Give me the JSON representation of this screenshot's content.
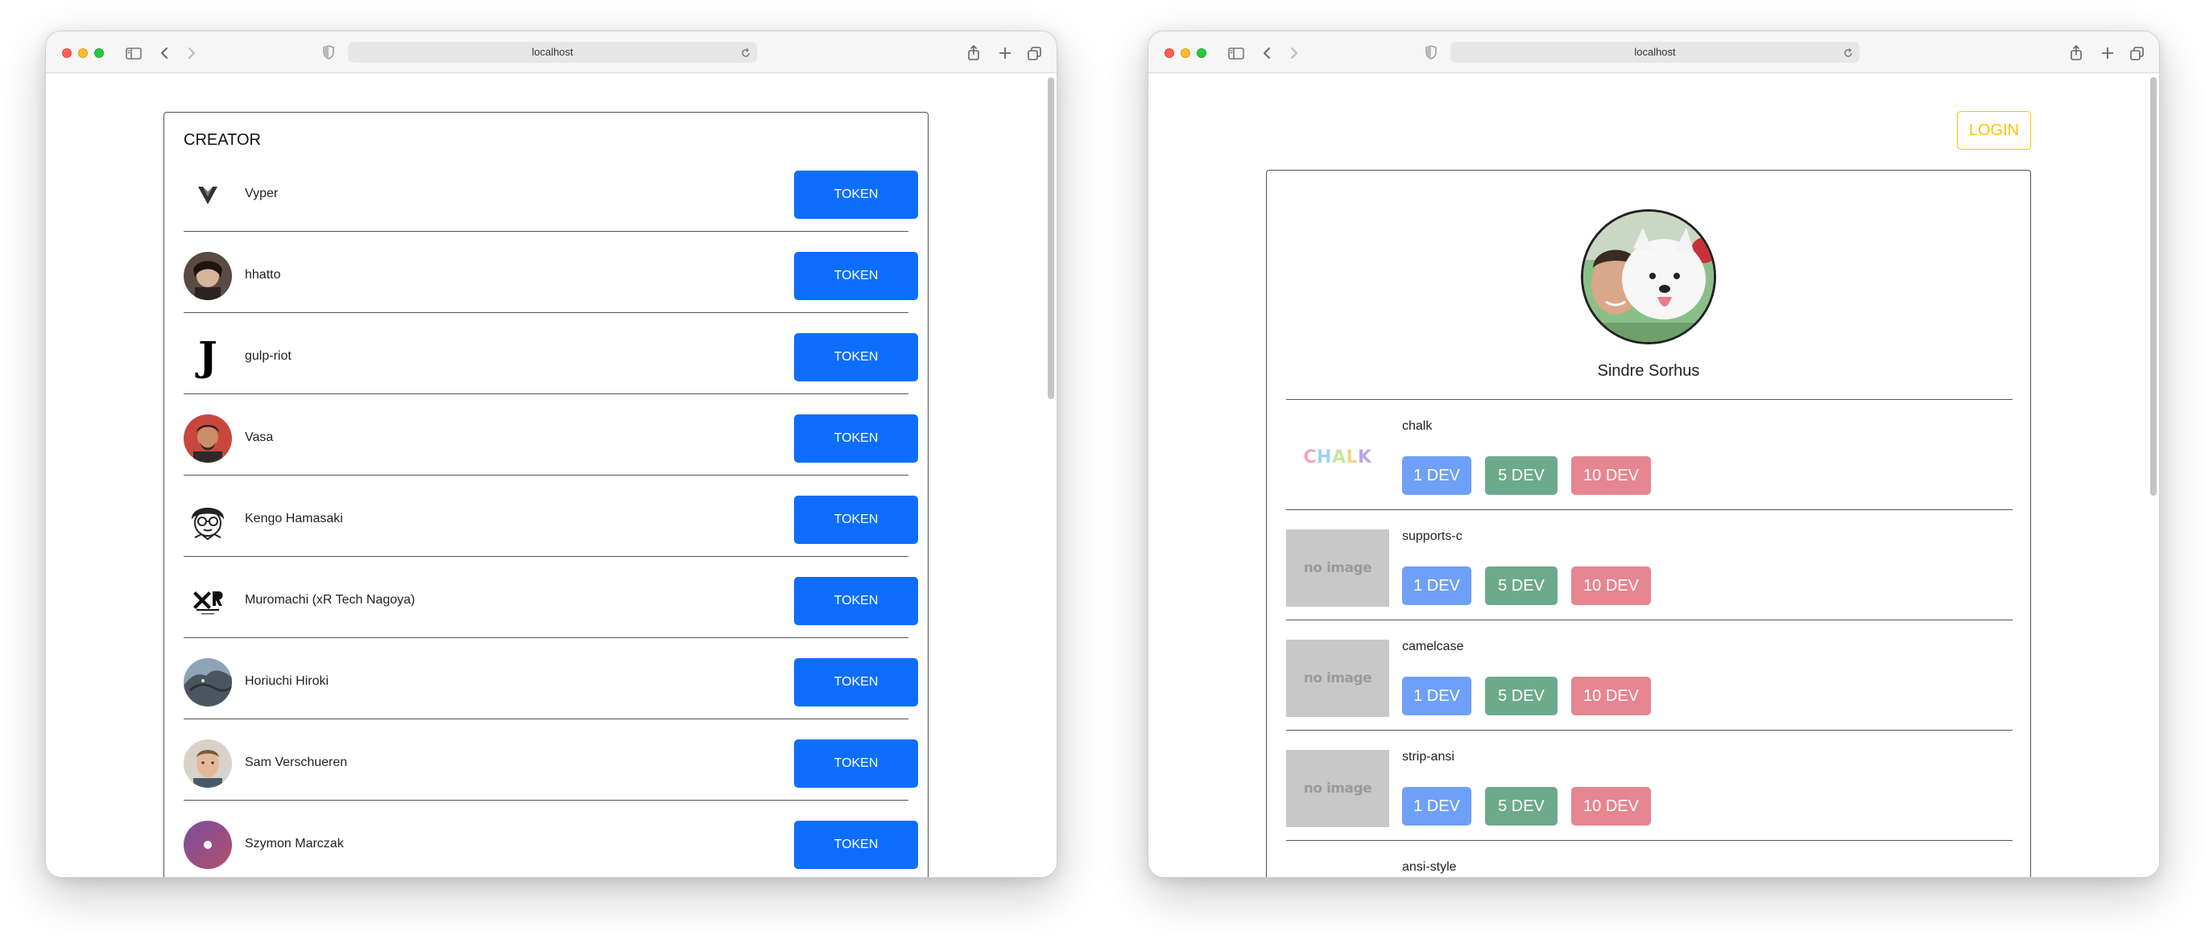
{
  "left_window": {
    "url": "localhost",
    "creator_heading": "CREATOR",
    "creators": [
      {
        "name": "Vyper",
        "button": "TOKEN",
        "avatar": "vyper-logo-icon"
      },
      {
        "name": "hhatto",
        "button": "TOKEN",
        "avatar": "user-photo"
      },
      {
        "name": "gulp-riot",
        "button": "TOKEN",
        "avatar": "blackletter-j-icon"
      },
      {
        "name": "Vasa",
        "button": "TOKEN",
        "avatar": "user-photo"
      },
      {
        "name": "Kengo Hamasaki",
        "button": "TOKEN",
        "avatar": "cartoon-face-icon"
      },
      {
        "name": "Muromachi (xR Tech Nagoya)",
        "button": "TOKEN",
        "avatar": "xr-logo-icon"
      },
      {
        "name": "Horiuchi Hiroki",
        "button": "TOKEN",
        "avatar": "dragon-photo"
      },
      {
        "name": "Sam Verschueren",
        "button": "TOKEN",
        "avatar": "user-photo"
      },
      {
        "name": "Szymon Marczak",
        "button": "TOKEN",
        "avatar": "purple-circle-icon"
      }
    ]
  },
  "right_window": {
    "url": "localhost",
    "login_label": "LOGIN",
    "profile_name": "Sindre Sorhus",
    "packages": [
      {
        "name": "chalk",
        "thumb": "CHALK",
        "buttons": [
          "1 DEV",
          "5 DEV",
          "10 DEV"
        ]
      },
      {
        "name": "supports-c",
        "thumb": "no image",
        "buttons": [
          "1 DEV",
          "5 DEV",
          "10 DEV"
        ]
      },
      {
        "name": "camelcase",
        "thumb": "no image",
        "buttons": [
          "1 DEV",
          "5 DEV",
          "10 DEV"
        ]
      },
      {
        "name": "strip-ansi",
        "thumb": "no image",
        "buttons": [
          "1 DEV",
          "5 DEV",
          "10 DEV"
        ]
      },
      {
        "name": "ansi-style"
      }
    ]
  },
  "colors": {
    "token_button": "#0d6efd",
    "login_outline": "#ffc107",
    "dev1": "#6ea0f7",
    "dev5": "#6daa8b",
    "dev10": "#e58690"
  }
}
